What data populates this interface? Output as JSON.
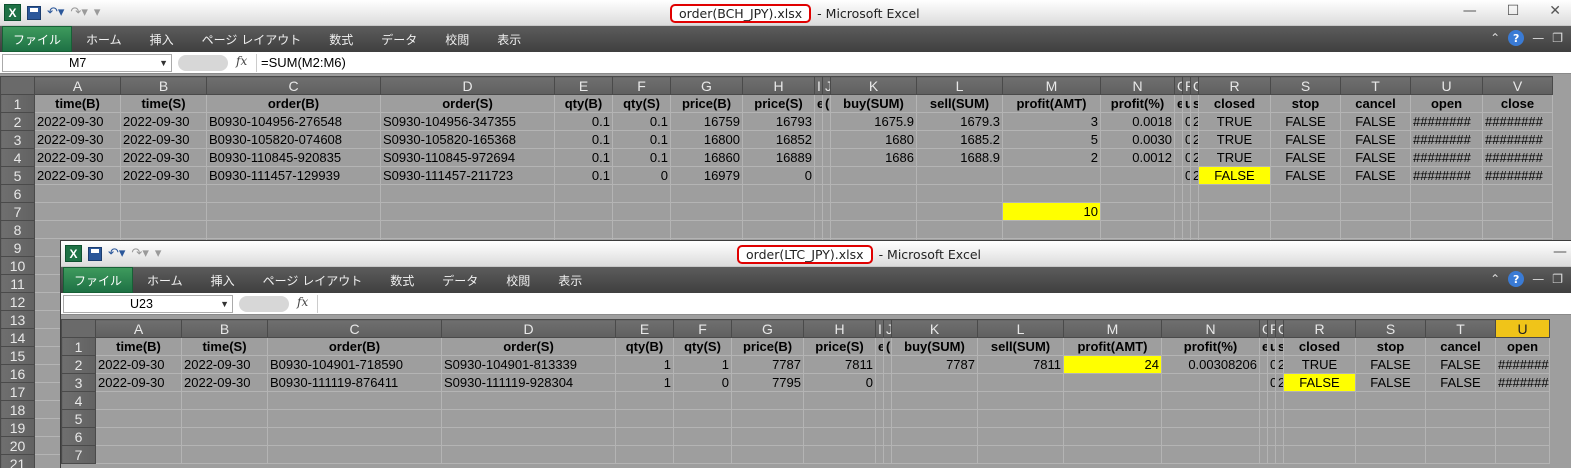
{
  "window1": {
    "filename": "order(BCH_JPY).xlsx",
    "app_title": "- Microsoft Excel",
    "tabs": [
      "ファイル",
      "ホーム",
      "挿入",
      "ページ レイアウト",
      "数式",
      "データ",
      "校閲",
      "表示"
    ],
    "namebox": "M7",
    "formula": "=SUM(M2:M6)",
    "columns": [
      "A",
      "B",
      "C",
      "D",
      "E",
      "F",
      "G",
      "H",
      "I",
      "J",
      "K",
      "L",
      "M",
      "N",
      "O",
      "P",
      "Q",
      "R",
      "S",
      "T",
      "U",
      "V"
    ],
    "rows": [
      [
        "1",
        "time(B)",
        "time(S)",
        "order(B)",
        "order(S)",
        "qty(B)",
        "qty(S)",
        "price(B)",
        "price(S)",
        "e(",
        "(B",
        "buy(SUM)",
        "sell(SUM)",
        "profit(AMT)",
        "profit(%)",
        "e",
        "unt",
        "se",
        "closed",
        "stop",
        "cancel",
        "open",
        "close"
      ],
      [
        "2",
        "2022-09-30",
        "2022-09-30",
        "B0930-104956-276548",
        "S0930-104956-347355",
        "0.1",
        "0.1",
        "16759",
        "16793",
        "",
        "",
        "1675.9",
        "1679.3",
        "3",
        "0.0018",
        "",
        "0",
        "20",
        "TRUE",
        "FALSE",
        "FALSE",
        "########",
        "########"
      ],
      [
        "3",
        "2022-09-30",
        "2022-09-30",
        "B0930-105820-074608",
        "S0930-105820-165368",
        "0.1",
        "0.1",
        "16800",
        "16852",
        "",
        "",
        "1680",
        "1685.2",
        "5",
        "0.0030",
        "",
        "0",
        "20",
        "TRUE",
        "FALSE",
        "FALSE",
        "########",
        "########"
      ],
      [
        "4",
        "2022-09-30",
        "2022-09-30",
        "B0930-110845-920835",
        "S0930-110845-972694",
        "0.1",
        "0.1",
        "16860",
        "16889",
        "",
        "",
        "1686",
        "1688.9",
        "2",
        "0.0012",
        "",
        "0",
        "20",
        "TRUE",
        "FALSE",
        "FALSE",
        "########",
        "########"
      ],
      [
        "5",
        "2022-09-30",
        "2022-09-30",
        "B0930-111457-129939",
        "S0930-111457-211723",
        "0.1",
        "0",
        "16979",
        "0",
        "",
        "",
        "",
        "",
        "",
        "",
        "",
        "0",
        "20",
        "FALSE",
        "FALSE",
        "FALSE",
        "########",
        "########"
      ],
      [
        "6",
        "",
        "",
        "",
        "",
        "",
        "",
        "",
        "",
        "",
        "",
        "",
        "",
        "",
        "",
        "",
        "",
        "",
        "",
        "",
        "",
        "",
        ""
      ],
      [
        "7",
        "",
        "",
        "",
        "",
        "",
        "",
        "",
        "",
        "",
        "",
        "",
        "",
        "10",
        "",
        "",
        "",
        "",
        "",
        "",
        "",
        "",
        ""
      ],
      [
        "8",
        "",
        "",
        "",
        "",
        "",
        "",
        "",
        "",
        "",
        "",
        "",
        "",
        "",
        "",
        "",
        "",
        "",
        "",
        "",
        "",
        "",
        ""
      ],
      [
        "9",
        "",
        "",
        "",
        "",
        "",
        "",
        "",
        "",
        "",
        "",
        "",
        "",
        "",
        "",
        "",
        "",
        "",
        "",
        "",
        "",
        "",
        ""
      ],
      [
        "10",
        "",
        "",
        "",
        "",
        "",
        "",
        "",
        "",
        "",
        "",
        "",
        "",
        "",
        "",
        "",
        "",
        "",
        "",
        "",
        "",
        "",
        ""
      ],
      [
        "11",
        "",
        "",
        "",
        "",
        "",
        "",
        "",
        "",
        "",
        "",
        "",
        "",
        "",
        "",
        "",
        "",
        "",
        "",
        "",
        "",
        "",
        ""
      ],
      [
        "12",
        "",
        "",
        "",
        "",
        "",
        "",
        "",
        "",
        "",
        "",
        "",
        "",
        "",
        "",
        "",
        "",
        "",
        "",
        "",
        "",
        "",
        ""
      ],
      [
        "13",
        "",
        "",
        "",
        "",
        "",
        "",
        "",
        "",
        "",
        "",
        "",
        "",
        "",
        "",
        "",
        "",
        "",
        "",
        "",
        "",
        "",
        ""
      ],
      [
        "14",
        "",
        "",
        "",
        "",
        "",
        "",
        "",
        "",
        "",
        "",
        "",
        "",
        "",
        "",
        "",
        "",
        "",
        "",
        "",
        "",
        "",
        ""
      ],
      [
        "15",
        "",
        "",
        "",
        "",
        "",
        "",
        "",
        "",
        "",
        "",
        "",
        "",
        "",
        "",
        "",
        "",
        "",
        "",
        "",
        "",
        "",
        ""
      ],
      [
        "16",
        "",
        "",
        "",
        "",
        "",
        "",
        "",
        "",
        "",
        "",
        "",
        "",
        "",
        "",
        "",
        "",
        "",
        "",
        "",
        "",
        "",
        ""
      ],
      [
        "17",
        "",
        "",
        "",
        "",
        "",
        "",
        "",
        "",
        "",
        "",
        "",
        "",
        "",
        "",
        "",
        "",
        "",
        "",
        "",
        "",
        "",
        ""
      ],
      [
        "18",
        "",
        "",
        "",
        "",
        "",
        "",
        "",
        "",
        "",
        "",
        "",
        "",
        "",
        "",
        "",
        "",
        "",
        "",
        "",
        "",
        "",
        ""
      ],
      [
        "19",
        "",
        "",
        "",
        "",
        "",
        "",
        "",
        "",
        "",
        "",
        "",
        "",
        "",
        "",
        "",
        "",
        "",
        "",
        "",
        "",
        "",
        ""
      ],
      [
        "20",
        "",
        "",
        "",
        "",
        "",
        "",
        "",
        "",
        "",
        "",
        "",
        "",
        "",
        "",
        "",
        "",
        "",
        "",
        "",
        "",
        "",
        ""
      ],
      [
        "21",
        "",
        "",
        "",
        "",
        "",
        "",
        "",
        "",
        "",
        "",
        "",
        "",
        "",
        "",
        "",
        "",
        "",
        "",
        "",
        "",
        "",
        ""
      ]
    ]
  },
  "window2": {
    "filename": "order(LTC_JPY).xlsx",
    "app_title": "- Microsoft Excel",
    "tabs": [
      "ファイル",
      "ホーム",
      "挿入",
      "ページ レイアウト",
      "数式",
      "データ",
      "校閲",
      "表示"
    ],
    "namebox": "U23",
    "formula": "",
    "columns": [
      "A",
      "B",
      "C",
      "D",
      "E",
      "F",
      "G",
      "H",
      "I",
      "J",
      "K",
      "L",
      "M",
      "N",
      "O",
      "P",
      "Q",
      "R",
      "S",
      "T",
      "U"
    ],
    "rows": [
      [
        "1",
        "time(B)",
        "time(S)",
        "order(B)",
        "order(S)",
        "qty(B)",
        "qty(S)",
        "price(B)",
        "price(S)",
        "e(",
        "(B",
        "buy(SUM)",
        "sell(SUM)",
        "profit(AMT)",
        "profit(%)",
        "e",
        "unt",
        "se",
        "closed",
        "stop",
        "cancel",
        "open"
      ],
      [
        "2",
        "2022-09-30",
        "2022-09-30",
        "B0930-104901-718590",
        "S0930-104901-813339",
        "1",
        "1",
        "7787",
        "7811",
        "",
        "",
        "7787",
        "7811",
        "24",
        "0.00308206",
        "",
        "0",
        "20",
        "TRUE",
        "FALSE",
        "FALSE",
        "########"
      ],
      [
        "3",
        "2022-09-30",
        "2022-09-30",
        "B0930-111119-876411",
        "S0930-111119-928304",
        "1",
        "0",
        "7795",
        "0",
        "",
        "",
        "",
        "",
        "",
        "",
        "",
        "0",
        "20",
        "FALSE",
        "FALSE",
        "FALSE",
        "########"
      ],
      [
        "4",
        "",
        "",
        "",
        "",
        "",
        "",
        "",
        "",
        "",
        "",
        "",
        "",
        "",
        "",
        "",
        "",
        "",
        "",
        "",
        "",
        ""
      ],
      [
        "5",
        "",
        "",
        "",
        "",
        "",
        "",
        "",
        "",
        "",
        "",
        "",
        "",
        "",
        "",
        "",
        "",
        "",
        "",
        "",
        "",
        ""
      ],
      [
        "6",
        "",
        "",
        "",
        "",
        "",
        "",
        "",
        "",
        "",
        "",
        "",
        "",
        "",
        "",
        "",
        "",
        "",
        "",
        "",
        "",
        ""
      ],
      [
        "7",
        "",
        "",
        "",
        "",
        "",
        "",
        "",
        "",
        "",
        "",
        "",
        "",
        "",
        "",
        "",
        "",
        "",
        "",
        "",
        "",
        ""
      ]
    ]
  },
  "colors": {
    "highlight": "#ffff00",
    "excel_green": "#1e7145",
    "cell_bg": "#9e9e9e",
    "title_outline": "#e00000"
  }
}
